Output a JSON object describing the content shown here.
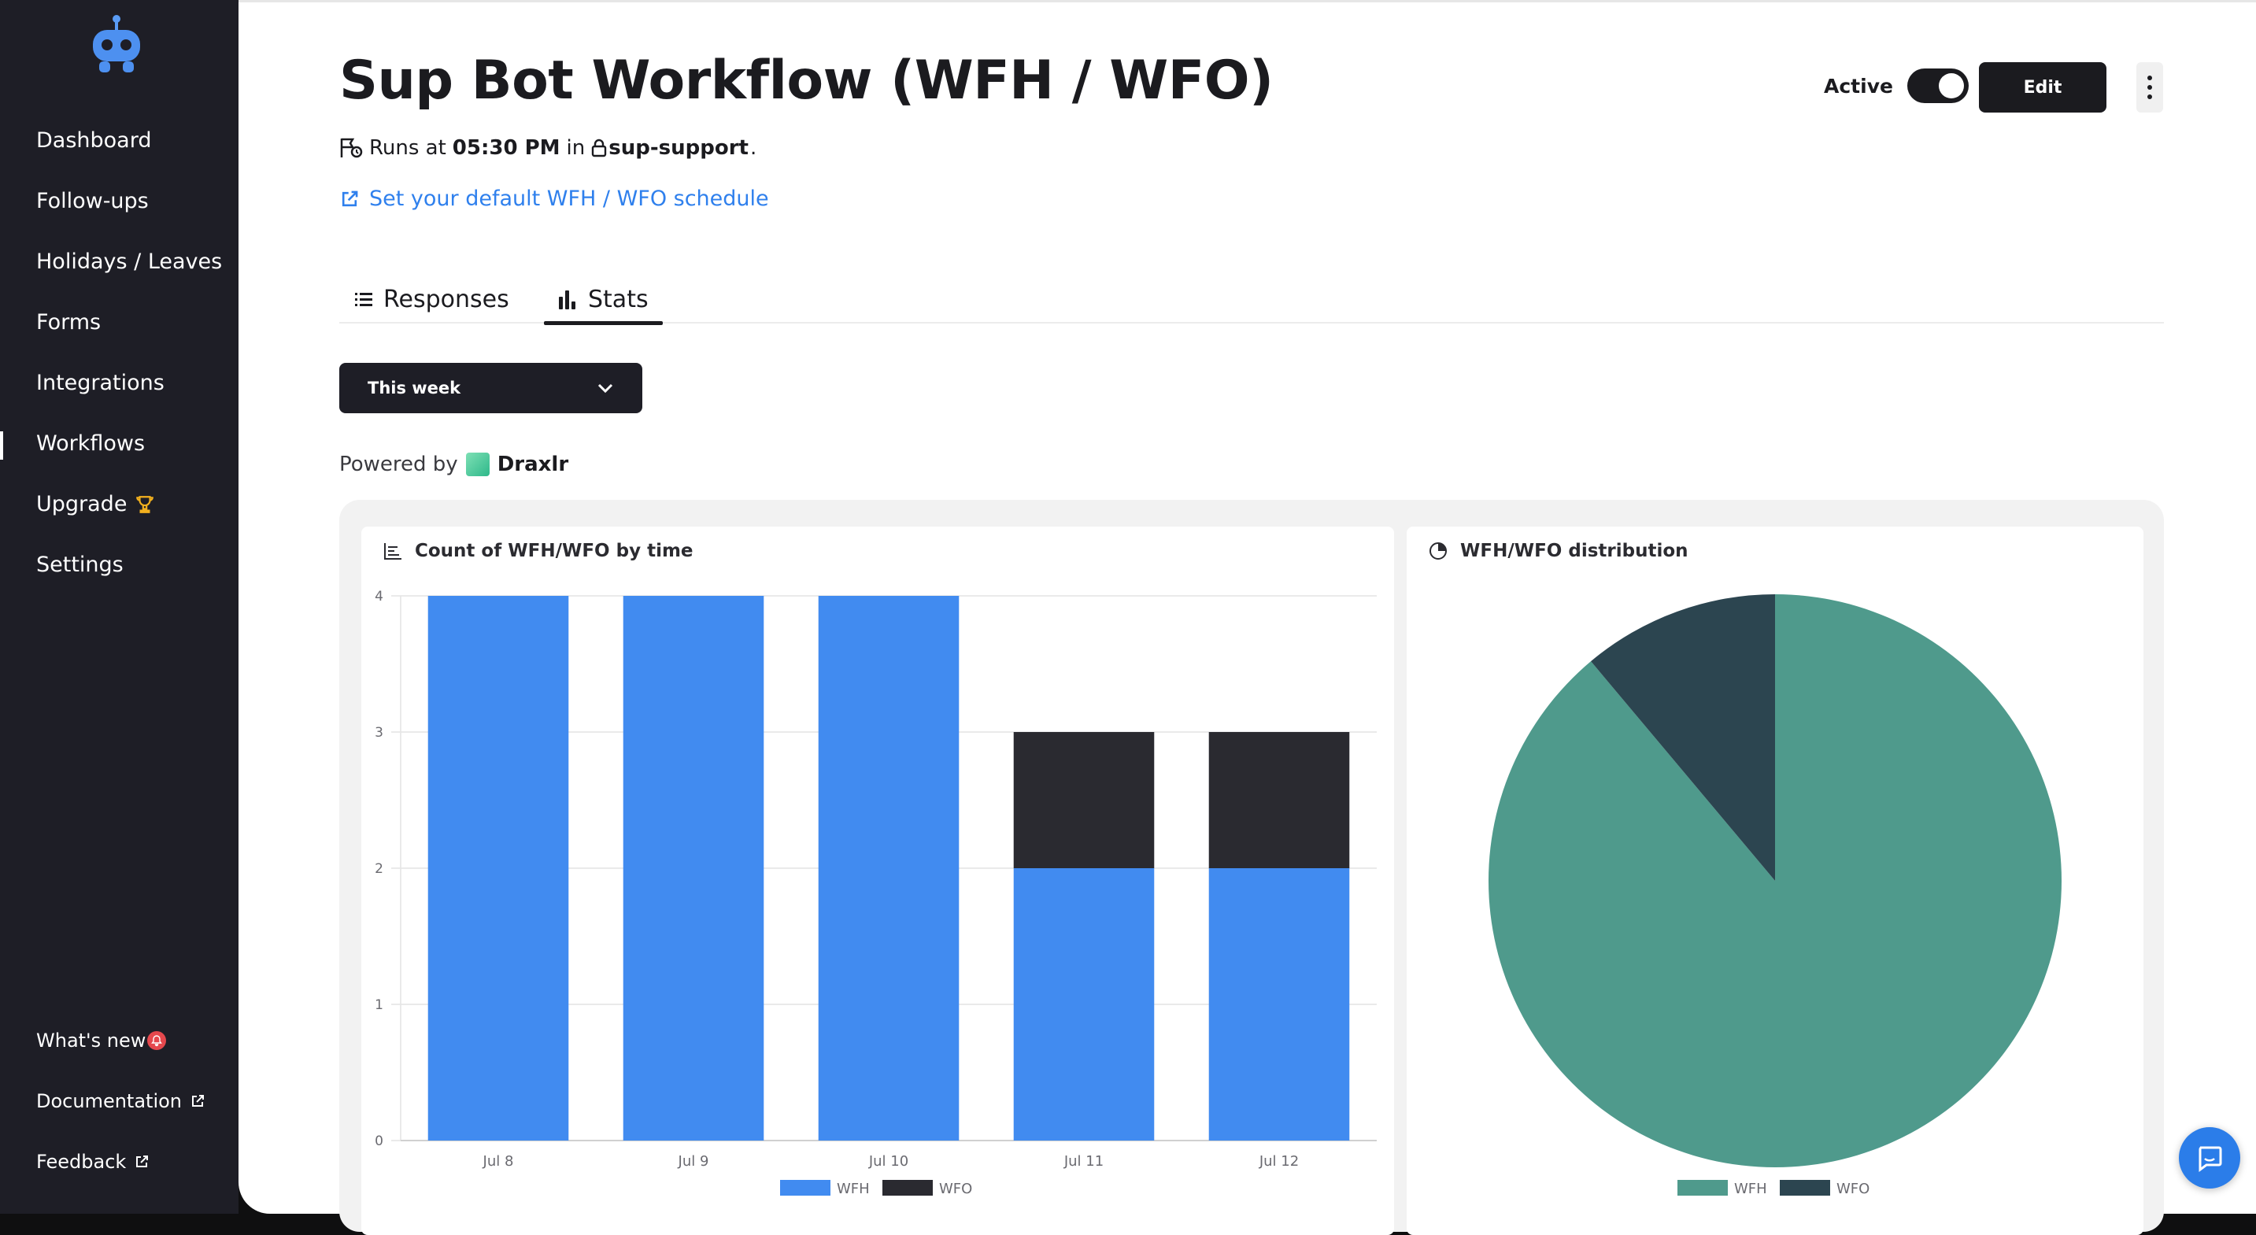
{
  "sidebar": {
    "items": [
      {
        "label": "Dashboard"
      },
      {
        "label": "Follow-ups"
      },
      {
        "label": "Holidays / Leaves"
      },
      {
        "label": "Forms"
      },
      {
        "label": "Integrations"
      },
      {
        "label": "Workflows"
      },
      {
        "label": "Upgrade"
      },
      {
        "label": "Settings"
      }
    ],
    "active": "Workflows",
    "bottom": [
      {
        "label": "What's new"
      },
      {
        "label": "Documentation"
      },
      {
        "label": "Feedback"
      }
    ]
  },
  "header": {
    "title": "Sup Bot Workflow (WFH / WFO)",
    "runs_prefix": "Runs at",
    "runs_time": "05:30 PM",
    "runs_in": "in",
    "channel": "sup-support",
    "schedule_link": "Set your default WFH / WFO schedule",
    "active_label": "Active",
    "active_on": true,
    "edit_label": "Edit"
  },
  "tabs": [
    {
      "label": "Responses"
    },
    {
      "label": "Stats"
    }
  ],
  "active_tab": "Stats",
  "filter": {
    "selected": "This week"
  },
  "powered": {
    "prefix": "Powered by",
    "brand": "Draxlr"
  },
  "colors": {
    "wfh_bar": "#418bf0",
    "wfo_bar": "#2a2a30",
    "wfh_pie": "#4f9a8c",
    "wfo_pie": "#2c4550",
    "link": "#2f80ed"
  },
  "chart_data": [
    {
      "type": "bar",
      "title": "Count of WFH/WFO by time",
      "stacked": true,
      "categories": [
        "Jul 8",
        "Jul 9",
        "Jul 10",
        "Jul 11",
        "Jul 12"
      ],
      "series": [
        {
          "name": "WFH",
          "values": [
            4,
            4,
            4,
            2,
            2
          ]
        },
        {
          "name": "WFO",
          "values": [
            0,
            0,
            0,
            1,
            1
          ]
        }
      ],
      "ylim": [
        0,
        4
      ],
      "yticks": [
        0,
        1,
        2,
        3,
        4
      ],
      "grid": true,
      "legend": "bottom"
    },
    {
      "type": "pie",
      "title": "WFH/WFO distribution",
      "labels": [
        "WFH",
        "WFO"
      ],
      "values": [
        16,
        2
      ],
      "legend": "bottom"
    }
  ]
}
